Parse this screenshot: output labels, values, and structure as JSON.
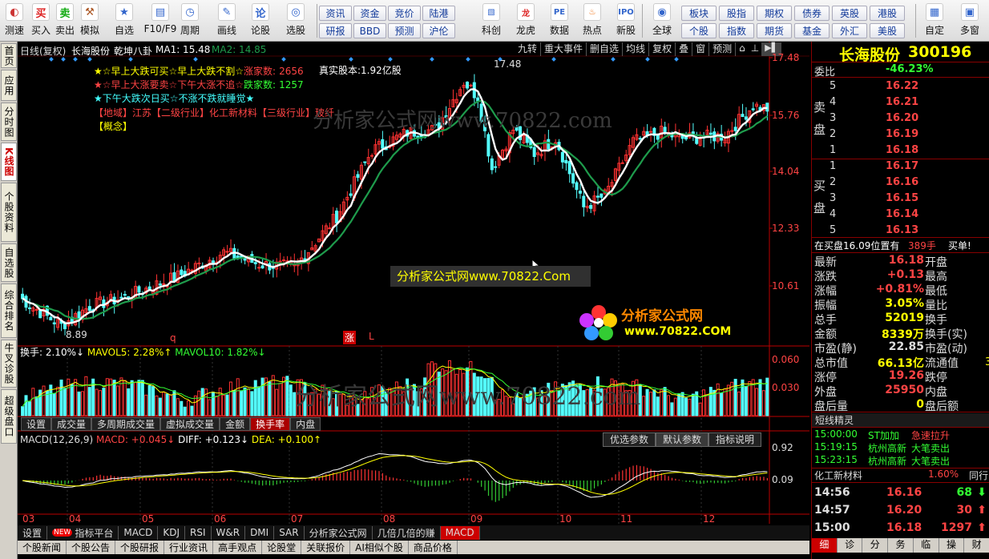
{
  "toolbar": {
    "buttons": [
      {
        "label": "测速",
        "icon": "speed-icon"
      },
      {
        "label": "买入",
        "icon": "buy-icon"
      },
      {
        "label": "卖出",
        "icon": "sell-icon"
      },
      {
        "label": "模拟",
        "icon": "hammer-icon"
      },
      {
        "label": "自选",
        "icon": "star-icon"
      },
      {
        "label": "F10/F9",
        "icon": "f10-icon"
      },
      {
        "label": "周期",
        "icon": "clock-icon"
      },
      {
        "label": "画线",
        "icon": "pen-icon"
      },
      {
        "label": "论股",
        "icon": "discuss-icon"
      },
      {
        "label": "选股",
        "icon": "select-icon"
      }
    ],
    "grid": [
      [
        "资讯",
        "资金",
        "竞价",
        "陆港"
      ],
      [
        "研报",
        "BBD",
        "预测",
        "沪伦"
      ]
    ],
    "buttons2": [
      {
        "label": "科创",
        "icon": "chart-icon"
      },
      {
        "label": "龙虎",
        "icon": "dragon-icon"
      },
      {
        "label": "数据",
        "icon": "pe-icon"
      },
      {
        "label": "热点",
        "icon": "hot-icon"
      },
      {
        "label": "新股",
        "icon": "ipo-icon"
      }
    ],
    "global": "全球",
    "grid2": [
      [
        "板块",
        "股指",
        "期权",
        "债券",
        "英股",
        "港股"
      ],
      [
        "个股",
        "指数",
        "期货",
        "基金",
        "外汇",
        "美股"
      ]
    ],
    "right": [
      {
        "label": "自定",
        "icon": "custom-icon"
      },
      {
        "label": "多窗",
        "icon": "windows-icon"
      }
    ]
  },
  "vtabs": [
    "首页",
    "应用",
    "分时图",
    "K线图",
    "个股资料",
    "自选股",
    "综合排名",
    "牛叉诊股",
    "超级盘口"
  ],
  "chart": {
    "header": {
      "mode": "日线(复权)",
      "name": "长海股份",
      "indicator": "乾坤八卦",
      "ma1": "MA1: 15.48",
      "ma2": "MA2: 14.85"
    },
    "top_buttons": [
      "九转",
      "重大事件",
      "删自选",
      "均线",
      "复权",
      "叠",
      "窗",
      "预测"
    ],
    "notes": {
      "line1a": "★☆早上大跌可买☆早上大跌不割☆",
      "line1b": "涨家数:",
      "line1c": "2656",
      "line2a": "★☆早上大涨要卖☆下午大涨不追☆",
      "line2b": "跌家数:",
      "line2c": "1257",
      "line3": "★下午大跌次日买☆不涨不跌就睡觉★",
      "line4": "【地域】江苏【二级行业】化工新材料【三级行业】玻纤",
      "line5": "【概念】",
      "capital": "真实股本:1.92亿股"
    },
    "high_label": "17.48",
    "low_label": "8.89",
    "marks": [
      "q",
      "涨",
      "L"
    ],
    "price_axis": [
      "17.48",
      "15.76",
      "14.04",
      "12.33",
      "10.61"
    ],
    "watermark_banner": "分析家公式网www.70822.Com",
    "logo": {
      "title": "分析家公式网",
      "url": "www.70822.COM"
    },
    "watermark_faded": "分析家公式网www.70822.com",
    "vol_header": {
      "a": "换手: 2.10%↓",
      "b": "MAVOL5: 2.28%↑",
      "c": "MAVOL10: 1.82%↓"
    },
    "vol_axis": [
      "0.060",
      "0.030"
    ],
    "vol_tabs": [
      "设置",
      "成交量",
      "多周期成交量",
      "虚拟成交量",
      "金额",
      "换手率",
      "内盘"
    ],
    "vol_active": "换手率",
    "macd_header": {
      "a": "MACD(12,26,9)",
      "b": "MACD: +0.045↓",
      "c": "DIFF: +0.123↓",
      "d": "DEA: +0.100↑"
    },
    "macd_buttons": [
      "优选参数",
      "默认参数",
      "指标说明"
    ],
    "macd_axis": [
      "0.92",
      "0.09"
    ],
    "months": [
      "03",
      "04",
      "05",
      "06",
      "07",
      "08",
      "09",
      "10",
      "11",
      "12"
    ],
    "bottom_tabs": [
      "设置",
      "指标平台",
      "MACD",
      "KDJ",
      "RSI",
      "W&R",
      "DMI",
      "SAR",
      "分析家公式网",
      "几倍几倍的赚",
      "MACD"
    ],
    "new_badge": "NEW",
    "bottom_tabs2": [
      "个股新闻",
      "个股公告",
      "个股研报",
      "行业资讯",
      "高手观点",
      "论股堂",
      "关联报价",
      "AI相似个股",
      "商品价格"
    ]
  },
  "quote": {
    "name": "长海股份",
    "code": "300196",
    "weibi_label": "委比",
    "weibi": "-46.23%",
    "sell_label": "卖盘",
    "buy_label": "买盘",
    "sells": [
      {
        "n": "5",
        "p": "16.22"
      },
      {
        "n": "4",
        "p": "16.21"
      },
      {
        "n": "3",
        "p": "16.20"
      },
      {
        "n": "2",
        "p": "16.19"
      },
      {
        "n": "1",
        "p": "16.18"
      }
    ],
    "buys": [
      {
        "n": "1",
        "p": "16.17"
      },
      {
        "n": "2",
        "p": "16.16"
      },
      {
        "n": "3",
        "p": "16.15"
      },
      {
        "n": "4",
        "p": "16.14"
      },
      {
        "n": "5",
        "p": "16.13"
      }
    ],
    "order_line": {
      "a": "在买盘16.09位置有",
      "b": "389手",
      "c": "买单!"
    },
    "stats": [
      {
        "l": "最新",
        "v": "16.18",
        "l2": "开盘",
        "c": "#f44"
      },
      {
        "l": "涨跌",
        "v": "+0.13",
        "l2": "最高",
        "c": "#f44"
      },
      {
        "l": "涨幅",
        "v": "+0.81%",
        "l2": "最低",
        "c": "#f44"
      },
      {
        "l": "振幅",
        "v": "3.05%",
        "l2": "量比",
        "c": "#ff0"
      },
      {
        "l": "总手",
        "v": "52019",
        "l2": "换手",
        "c": "#ff0"
      },
      {
        "l": "金额",
        "v": "8339万",
        "l2": "换手(实)",
        "c": "#ff0"
      },
      {
        "l": "市盈(静)",
        "v": "22.85",
        "l2": "市盈(动)",
        "c": "#ddd"
      },
      {
        "l": "总市值",
        "v": "66.13亿",
        "l2": "流通值",
        "c": "#ff0"
      },
      {
        "l": "涨停",
        "v": "19.26",
        "l2": "跌停",
        "c": "#f44"
      },
      {
        "l": "外盘",
        "v": "25950",
        "l2": "内盘",
        "c": "#f44"
      },
      {
        "l": "盘后量",
        "v": "0",
        "l2": "盘后额",
        "c": "#ff0"
      }
    ],
    "flow_extra": "3",
    "short_title": "短线精灵",
    "short": [
      {
        "t": "15:00:00",
        "s": "ST加加",
        "e": "急速拉升"
      },
      {
        "t": "15:19:15",
        "s": "杭州高新",
        "e": "大笔卖出"
      },
      {
        "t": "15:23:15",
        "s": "杭州高新",
        "e": "大笔卖出"
      }
    ],
    "sector": {
      "name": "化工新材料",
      "pct": "1.60%",
      "tag": "同行"
    },
    "ticks": [
      {
        "t": "14:56",
        "p": "16.16",
        "v": "68",
        "dir": "down"
      },
      {
        "t": "14:57",
        "p": "16.20",
        "v": "30",
        "dir": "up"
      },
      {
        "t": "15:00",
        "p": "16.18",
        "v": "1297",
        "dir": "up"
      }
    ],
    "bottom_tabs": [
      "细",
      "诊",
      "分",
      "务",
      "临",
      "操",
      "财"
    ]
  },
  "colors": {
    "up": "#ff3232",
    "down": "#54ffff",
    "ma1": "#ffffff",
    "ma2": "#1e9c4c",
    "axis": "#b00000"
  }
}
